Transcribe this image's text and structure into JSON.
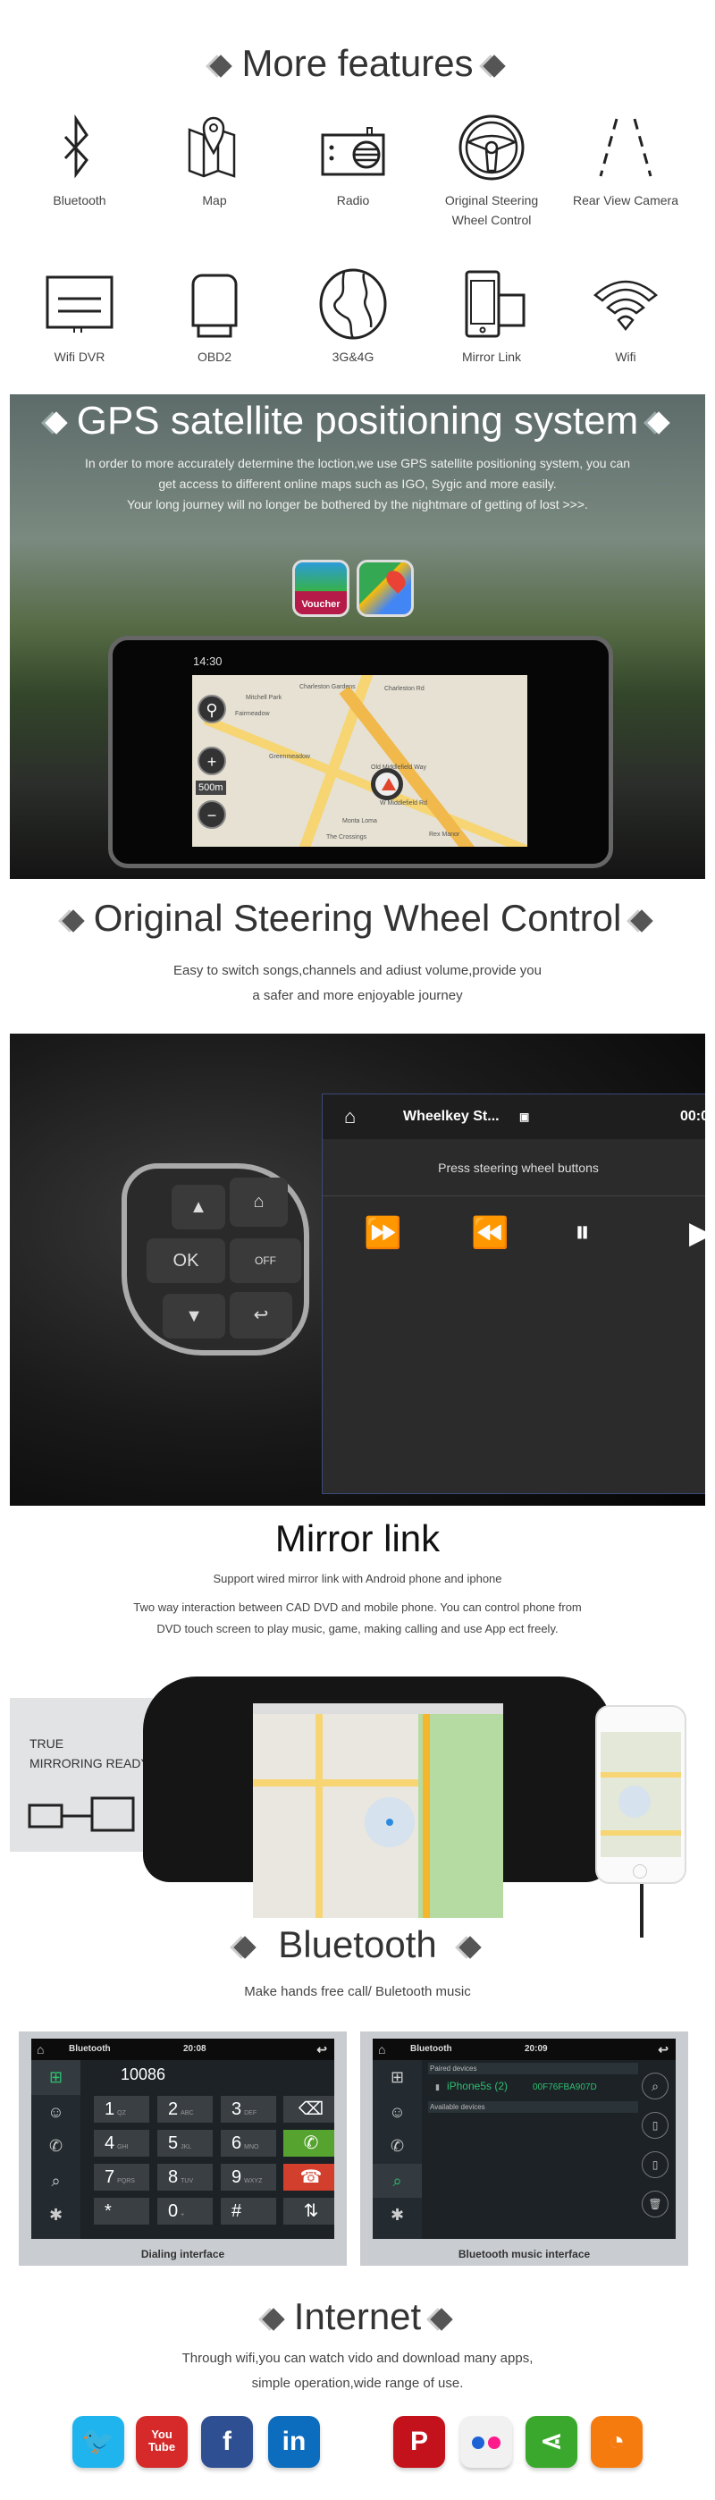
{
  "features": {
    "title": "More features",
    "items": [
      {
        "label": "Bluetooth",
        "icon": "bluetooth-icon"
      },
      {
        "label": "Map",
        "icon": "map-icon"
      },
      {
        "label": "Radio",
        "icon": "radio-icon"
      },
      {
        "label": "Original Steering Wheel Control",
        "icon": "steering-wheel-icon"
      },
      {
        "label": "Rear View Camera",
        "icon": "rear-camera-lines-icon"
      },
      {
        "label": "Wifi DVR",
        "icon": "dvr-icon"
      },
      {
        "label": "OBD2",
        "icon": "obd2-icon"
      },
      {
        "label": "3G&4G",
        "icon": "globe-icon"
      },
      {
        "label": "Mirror Link",
        "icon": "mirror-link-icon"
      },
      {
        "label": "Wifi",
        "icon": "wifi-icon"
      }
    ]
  },
  "gps": {
    "title": "GPS satellite positioning system",
    "lines": [
      "In order to more accurately determine the loction,we use GPS satellite positioning system, you can",
      "get access to different online maps such as IGO, Sygic and more easily.",
      "Your long journey will no longer be bothered by the nightmare of getting of lost  >>>."
    ],
    "voucher_label": "Voucher",
    "time": "14:30",
    "scale": "500m",
    "map_labels": [
      "Charleston Gardens",
      "Mitchell Park",
      "Fairmeadow",
      "Greenmeadow",
      "Old Middlefield Way",
      "W Middlefield Rd",
      "Monta Loma",
      "The Crossings",
      "Rex Manor",
      "Charleston Rd"
    ]
  },
  "steering": {
    "title": "Original Steering Wheel Control",
    "lines": [
      "Easy to switch songs,channels and adiust volume,provide you",
      "a safer and more enjoyable journey"
    ],
    "ok_label": "OK",
    "off_label": "OFF",
    "app_title": "Wheelkey St...",
    "clock": "00:0",
    "message": "Press steering wheel buttons"
  },
  "mirror": {
    "title": "Mirror link",
    "subtitle": "Support wired mirror link with Android phone and iphone",
    "lines": [
      "Two way interaction between CAD DVD and mobile phone. You can control phone from",
      "DVD touch screen to play music, game, making calling and use App ect freely."
    ],
    "badge_lines": [
      "TRUE",
      "MIRRORING READY"
    ]
  },
  "bluetooth": {
    "title": "Bluetooth",
    "subtitle": "Make hands free call/ Buletooth music",
    "dial": {
      "app": "Bluetooth",
      "time": "20:08",
      "number": "10086",
      "keys": [
        [
          "1",
          "QZ"
        ],
        [
          "2",
          "ABC"
        ],
        [
          "3",
          "DEF"
        ],
        [
          "4",
          "GHI"
        ],
        [
          "5",
          "JKL"
        ],
        [
          "6",
          "MNO"
        ],
        [
          "7",
          "PQRS"
        ],
        [
          "8",
          "TUV"
        ],
        [
          "9",
          "WXYZ"
        ],
        [
          "*",
          ""
        ],
        [
          "0",
          "+"
        ],
        [
          "#",
          ""
        ]
      ],
      "caption": "Dialing interface"
    },
    "music": {
      "app": "Bluetooth",
      "time": "20:09",
      "paired_header": "Paired devices",
      "device_name": "iPhone5s (2)",
      "device_mac": "00F76FBA907D",
      "available_header": "Available devices",
      "caption": "Bluetooth music interface"
    },
    "accent": "#2fbf71"
  },
  "internet": {
    "title": "Internet",
    "lines": [
      "Through wifi,you can watch vido and download many apps,",
      "simple operation,wide range of use."
    ],
    "apps": [
      {
        "name": "twitter-icon",
        "color": "#1fb4ee"
      },
      {
        "name": "youtube-icon",
        "color": "#d62a2a",
        "text": "You Tube"
      },
      {
        "name": "facebook-icon",
        "color": "#2f4f93",
        "text": "f"
      },
      {
        "name": "linkedin-icon",
        "color": "#0c6cbd",
        "text": "in"
      },
      {
        "name": "pinterest-icon",
        "color": "#c3121b",
        "text": "P"
      },
      {
        "name": "flickr-icon",
        "color": "#f1f1f1"
      },
      {
        "name": "share-icon",
        "color": "#3aa82c"
      },
      {
        "name": "rss-icon",
        "color": "#f57b0f"
      }
    ]
  }
}
